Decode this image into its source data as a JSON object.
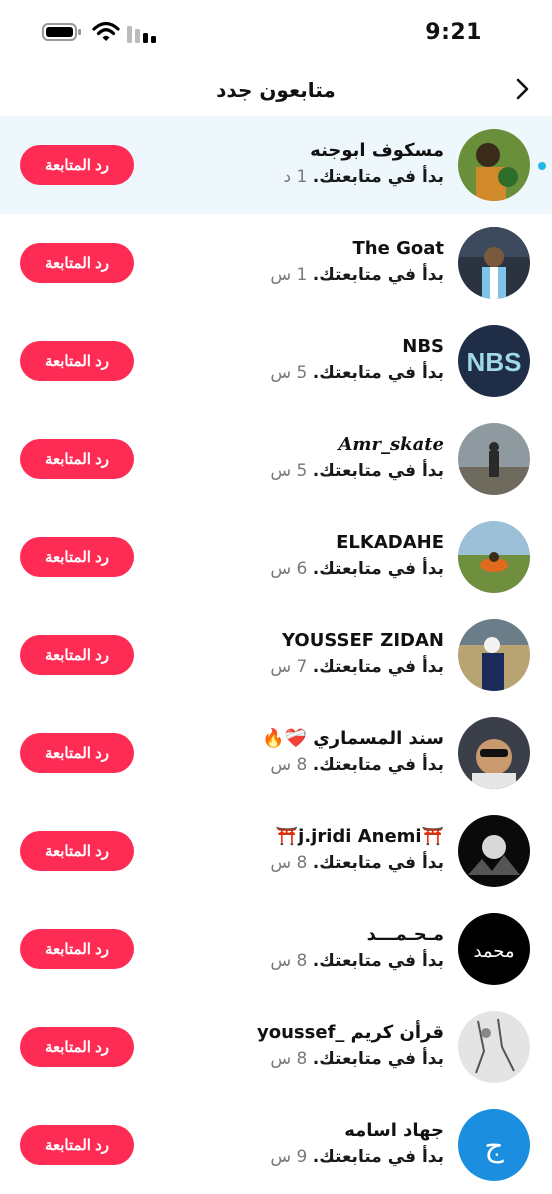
{
  "status_bar": {
    "time": "9:21"
  },
  "header": {
    "title": "متابعون جدد"
  },
  "colors": {
    "accent": "#fe2c55",
    "unread_bg": "#eef8fc",
    "unread_dot": "#20b8e8"
  },
  "follow_back_label": "رد المتابعة",
  "followers": [
    {
      "name": "مسكوف ابوجنه",
      "action": "بدأ في متابعتك.",
      "time": "1 د",
      "unread": true
    },
    {
      "name": "The Goat",
      "action": "بدأ في متابعتك.",
      "time": "1 س"
    },
    {
      "name": "NBS",
      "action": "بدأ في متابعتك.",
      "time": "5 س",
      "avatar_text": "NBS"
    },
    {
      "name": "𝑨𝒎𝒓_𝒔𝒌𝒂𝒕𝒆",
      "action": "بدأ في متابعتك.",
      "time": "5 س"
    },
    {
      "name": "ELKADAHE",
      "action": "بدأ في متابعتك.",
      "time": "6 س"
    },
    {
      "name": "YOUSSEF ZIDAN",
      "action": "بدأ في متابعتك.",
      "time": "7 س"
    },
    {
      "name": "سند المسماري ❤️‍🩹🔥",
      "action": "بدأ في متابعتك.",
      "time": "8 س"
    },
    {
      "name": "⛩️j.jridi Anemi⛩️",
      "action": "بدأ في متابعتك.",
      "time": "8 س"
    },
    {
      "name": "مـحـمـــد",
      "action": "بدأ في متابعتك.",
      "time": "8 س",
      "avatar_text": "محمد"
    },
    {
      "name": "قرأن كريم _youssef",
      "action": "بدأ في متابعتك.",
      "time": "8 س"
    },
    {
      "name": "جهاد اسامه",
      "action": "بدأ في متابعتك.",
      "time": "9 س",
      "avatar_text": "ج"
    }
  ]
}
